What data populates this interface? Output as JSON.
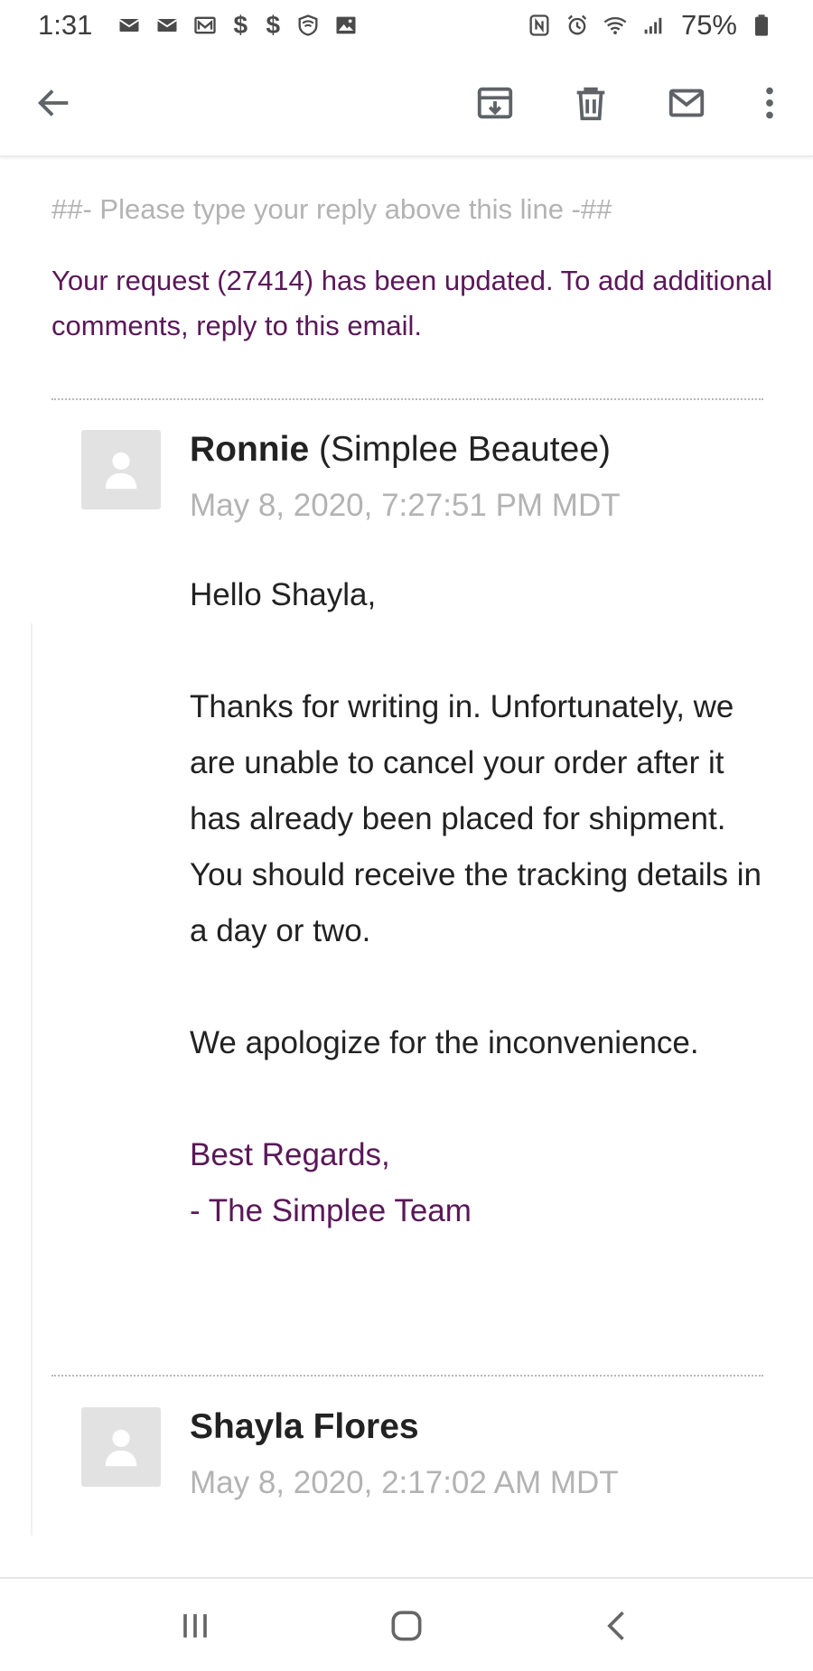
{
  "status_bar": {
    "time": "1:31",
    "battery": "75%",
    "left_icons": [
      "gmail-icon",
      "gmail-icon",
      "gmail-icon",
      "dollar-icon",
      "dollar-icon",
      "shield-icon",
      "image-icon"
    ],
    "dollar_symbol": "$",
    "right_icons": [
      "nfc-icon",
      "alarm-icon",
      "wifi-icon",
      "signal-icon",
      "battery-icon"
    ]
  },
  "app_bar": {
    "icons": [
      "back-arrow-icon",
      "archive-icon",
      "delete-icon",
      "mail-icon",
      "more-vert-icon"
    ]
  },
  "email": {
    "reply_line": "##- Please type your reply above this line -##",
    "request_notice": "Your request (27414) has been updated. To add additional comments, reply to this email.",
    "messages": [
      {
        "sender_name": "Ronnie",
        "sender_org": " (Simplee Beautee)",
        "timestamp": "May 8, 2020, 7:27:51 PM MDT",
        "greeting": "Hello Shayla,",
        "paragraph": "Thanks for writing in. Unfortunately, we are unable to cancel your order after it has already been placed for shipment. You should receive the tracking details in a day or two.",
        "apology": "We apologize for the inconvenience.",
        "signoff_1": "Best Regards,",
        "signoff_2": "- The Simplee Team"
      },
      {
        "sender_name": "Shayla Flores",
        "timestamp": "May 8, 2020, 2:17:02 AM MDT"
      }
    ]
  },
  "colors": {
    "accent_purple": "#5a1858",
    "muted_gray": "#b3b3b3",
    "text_dark": "#222222"
  },
  "nav_bar": {
    "icons": [
      "recents-icon",
      "home-icon",
      "nav-back-icon"
    ]
  }
}
